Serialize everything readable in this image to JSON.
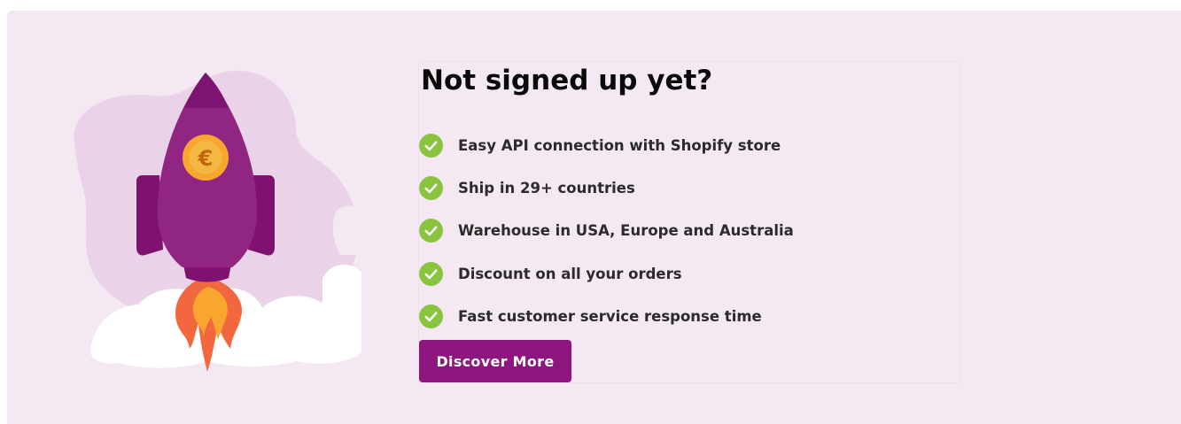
{
  "promo": {
    "title": "Not signed up yet?",
    "features": [
      "Easy API connection with Shopify store",
      "Ship in 29+ countries",
      "Warehouse in USA, Europe and Australia",
      "Discount on all your orders",
      "Fast customer service response time"
    ],
    "cta_label": "Discover More",
    "coin_symbol": "€"
  },
  "icons": {
    "feature_bullet": "check-circle-icon",
    "illustration": "rocket-illustration"
  },
  "colors": {
    "background": "#f4e8f3",
    "accent": "#8e177f",
    "check": "#8ac43f",
    "flame": "#f2673e",
    "coin": "#f9a631"
  }
}
